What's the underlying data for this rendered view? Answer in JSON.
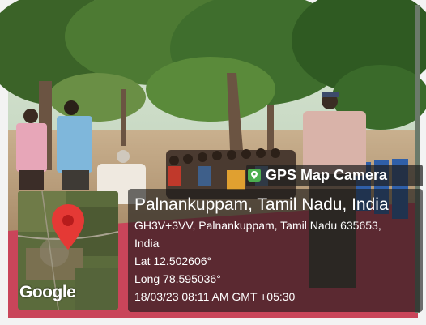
{
  "stamp": {
    "app_name": "GPS Map Camera",
    "location_title": "Palnankuppam, Tamil Nadu, India",
    "address_line1": "GH3V+3VV, Palnankuppam, Tamil Nadu 635653,",
    "address_line2": "India",
    "latitude": "Lat 12.502606°",
    "longitude": "Long 78.595036°",
    "datetime": "18/03/23 08:11 AM GMT +05:30",
    "map_logo": "Google",
    "map_pin_icon": "location-pin-icon"
  },
  "colors": {
    "panel_bg": "#1e1e1e",
    "pin_red": "#e53935",
    "foliage": "#3f6e2d",
    "ground": "#b79a78",
    "carpet": "#c9455a"
  }
}
